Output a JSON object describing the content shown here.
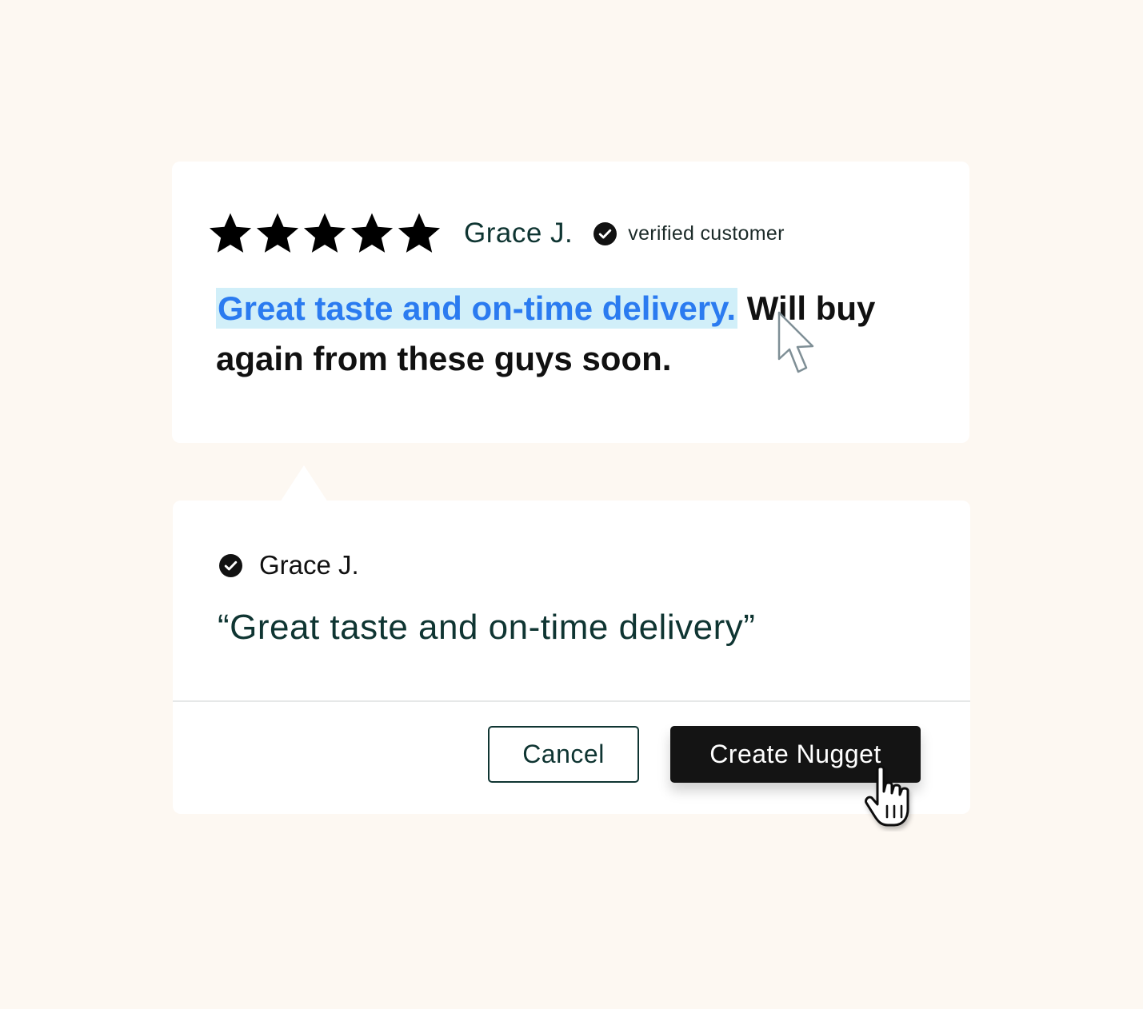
{
  "review": {
    "rating": 5,
    "rating_max": 5,
    "author": "Grace J.",
    "verified_label": "verified customer",
    "highlighted_text": "Great taste and on-time delivery.",
    "rest_text_line1": " Will buy",
    "rest_text_line2": "again from these guys soon."
  },
  "nugget": {
    "author": "Grace J.",
    "quote": "“Great taste and on-time delivery”",
    "cancel_label": "Cancel",
    "create_label": "Create Nugget"
  },
  "colors": {
    "background": "#fdf8f2",
    "highlight_bg": "#d1eff9",
    "highlight_text": "#2b7bf0",
    "dark_green_text": "#0f3532",
    "primary_button": "#141414"
  },
  "icons": {
    "star": "star-icon",
    "verified": "check-circle-icon",
    "arrow_cursor": "arrow-cursor-icon",
    "hand_cursor": "hand-pointer-icon"
  }
}
